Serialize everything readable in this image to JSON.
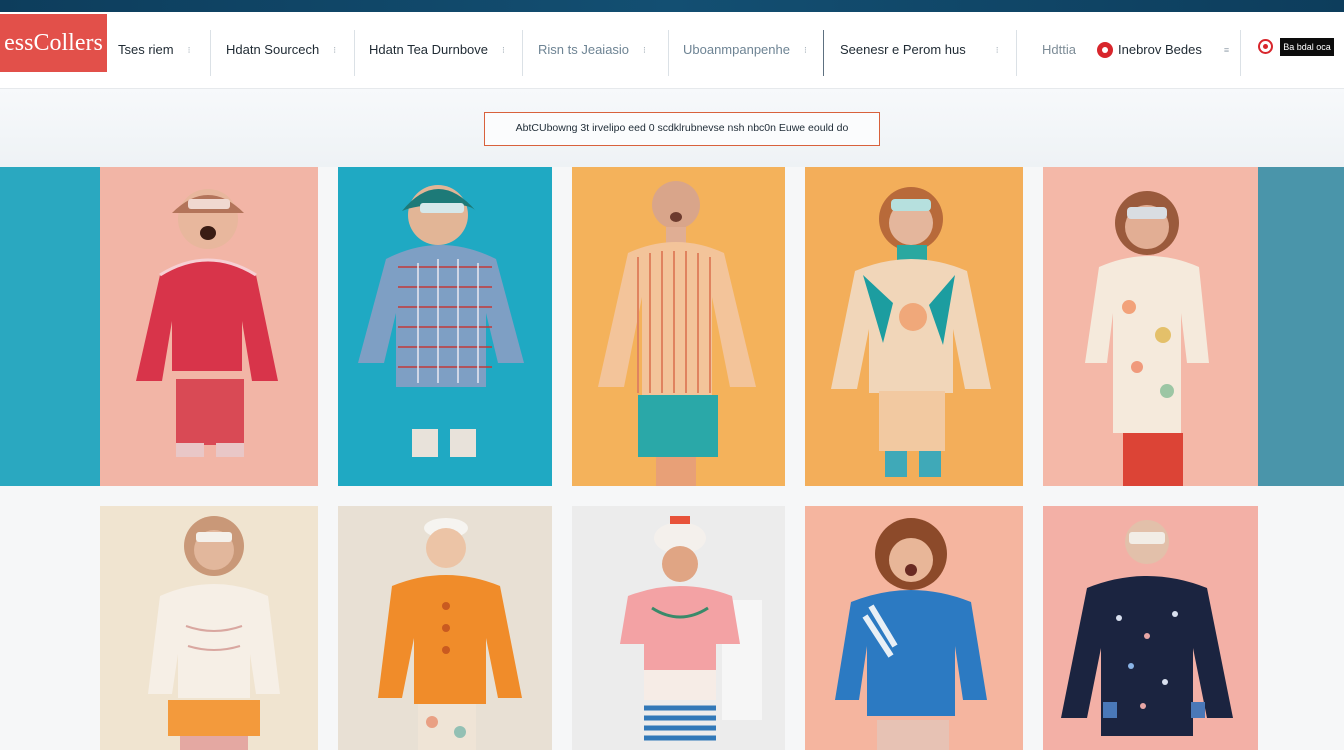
{
  "brand": {
    "logo_text": "essCollers",
    "logo_color": "#e2504a"
  },
  "nav": {
    "items": [
      {
        "label": "Tses riem"
      },
      {
        "label": "Hdatn Sourcech"
      },
      {
        "label": "Hdatn Tea Durnbove"
      },
      {
        "label": "Risn ts Jeaiasio"
      },
      {
        "label": "Uboanmpanpenhe"
      },
      {
        "label": "Seenesr e Perom hus"
      },
      {
        "label": "Hdttia"
      },
      {
        "label": "Inebrov Bedes"
      }
    ],
    "chevron_glyph": "⁝",
    "badge_text": "Ba bdal oca"
  },
  "announcement": {
    "text": "AbtCUbowng 3t irvelipo eed 0 scdklrubnevse nsh nbc0n Euwe eould do"
  },
  "colors": {
    "nav_bar_top": "#134f72",
    "accent_red": "#d8262c",
    "card_backgrounds": [
      "#f2b5a6",
      "#1fa9c3",
      "#f4b25b",
      "#f3ae5a",
      "#f4b8a8",
      "#f0e4d0",
      "#e8e0d4",
      "#ececec",
      "#f5b59f",
      "#f3b0a6"
    ]
  },
  "products": [
    {
      "name": "doll-red-knit-sweater"
    },
    {
      "name": "doll-blue-plaid-dress"
    },
    {
      "name": "doll-striped-shirt"
    },
    {
      "name": "doll-teal-floral-outfit"
    },
    {
      "name": "doll-white-floral-dress"
    },
    {
      "name": "doll-cream-sweater"
    },
    {
      "name": "doll-orange-sweater"
    },
    {
      "name": "doll-pink-blouse"
    },
    {
      "name": "doll-blue-knit-sweater"
    },
    {
      "name": "doll-navy-print-coat"
    }
  ]
}
